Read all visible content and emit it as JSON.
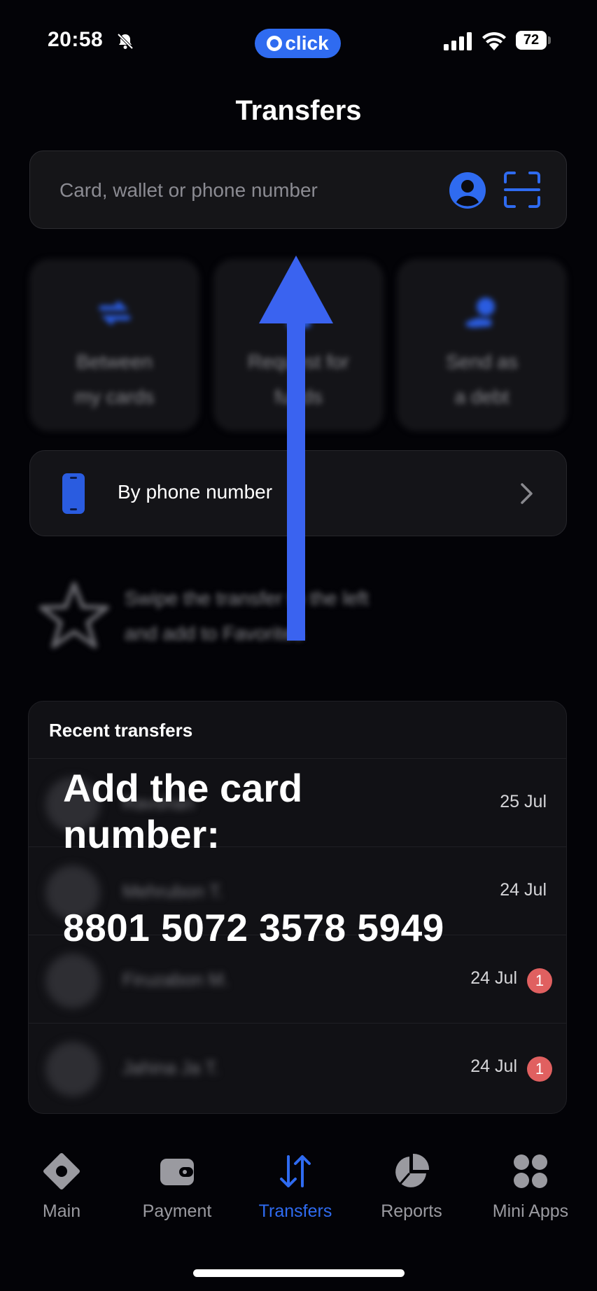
{
  "status_bar": {
    "time": "20:58",
    "app_pill": "click",
    "battery": "72",
    "icons": [
      "bell-slash-icon",
      "signal-icon",
      "wifi-icon",
      "battery-icon"
    ]
  },
  "header": {
    "title": "Transfers"
  },
  "search": {
    "placeholder": "Card, wallet or phone number",
    "value": "",
    "icons": [
      "contact-icon",
      "scan-icon"
    ]
  },
  "quick_actions": [
    {
      "label": "Between\nmy cards",
      "icon": "cards-swap-icon"
    },
    {
      "label": "Request for\nfunds",
      "icon": "request-icon"
    },
    {
      "label": "Send as\na debt",
      "icon": "debt-icon"
    }
  ],
  "phone_row": {
    "label": "By phone number",
    "icon": "phone-icon"
  },
  "favorites_hint": {
    "text": "Swipe the transfer to the left\nand add to Favorites",
    "icon": "star-icon"
  },
  "recent": {
    "title": "Recent transfers",
    "items": [
      {
        "name": "Ravshan",
        "date": "25 Jul",
        "badge": ""
      },
      {
        "name": "Mehrubon T.",
        "date": "24 Jul",
        "badge": ""
      },
      {
        "name": "Firuzabon M.",
        "date": "24 Jul",
        "badge": "1"
      },
      {
        "name": "Jahina Ja T.",
        "date": "24 Jul",
        "badge": "1"
      }
    ]
  },
  "overlay": {
    "instruction": "Add the card\nnumber:",
    "card_number": "8801 5072 3578 5949",
    "arrow_color": "#3a63f0"
  },
  "tab_bar": {
    "items": [
      {
        "label": "Main",
        "icon": "main-icon",
        "active": false
      },
      {
        "label": "Payment",
        "icon": "wallet-icon",
        "active": false
      },
      {
        "label": "Transfers",
        "icon": "transfers-icon",
        "active": true
      },
      {
        "label": "Reports",
        "icon": "pie-chart-icon",
        "active": false
      },
      {
        "label": "Mini Apps",
        "icon": "grid-icon",
        "active": false
      }
    ]
  },
  "colors": {
    "background": "#030307",
    "accent": "#2f6bf0",
    "badge": "#e06060",
    "card": "#141418"
  }
}
